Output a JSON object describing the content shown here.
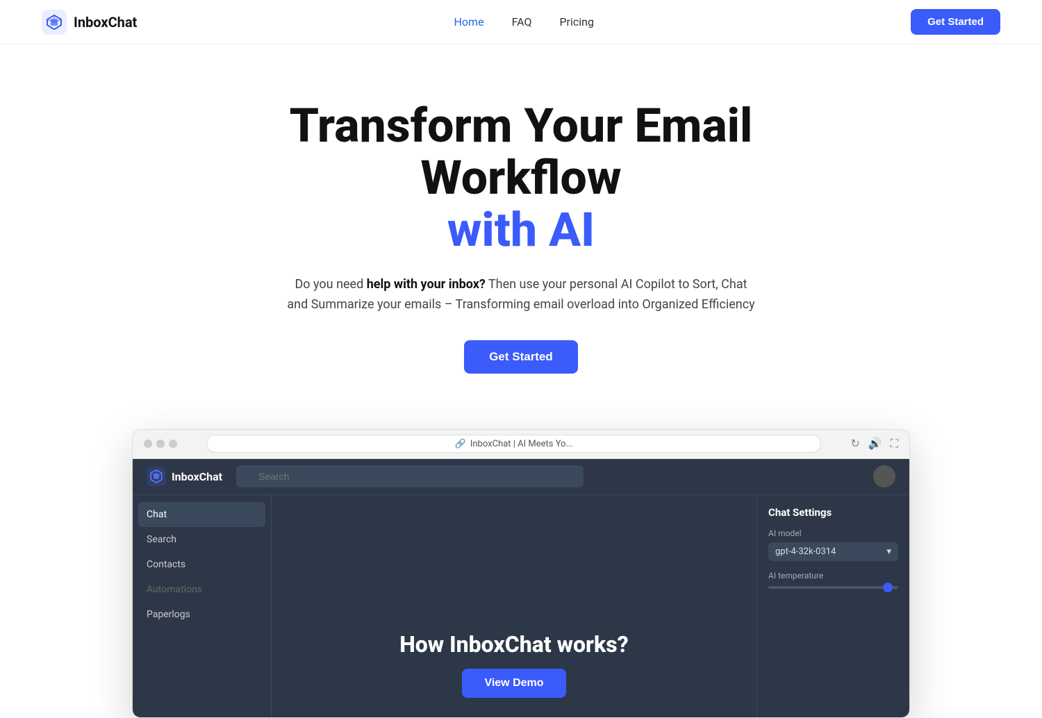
{
  "nav": {
    "logo_text": "InboxChat",
    "links": [
      {
        "label": "Home",
        "active": true
      },
      {
        "label": "FAQ",
        "active": false
      },
      {
        "label": "Pricing",
        "active": false
      }
    ],
    "cta_label": "Get Started"
  },
  "hero": {
    "title_line1": "Transform Your Email Workflow",
    "title_line2": "with AI",
    "subtitle_prefix": "Do you need ",
    "subtitle_bold": "help with your inbox?",
    "subtitle_suffix": " Then use your personal AI Copilot to Sort, Chat and Summarize your emails – Transforming email overload into Organized Efficiency",
    "cta_label": "Get Started"
  },
  "browser": {
    "url_text": "InboxChat | AI Meets Yo...",
    "url_icon": "🔗"
  },
  "app": {
    "logo": "InboxChat",
    "search_placeholder": "Search",
    "sidebar_items": [
      {
        "label": "Chat",
        "active": true
      },
      {
        "label": "Search",
        "active": false
      },
      {
        "label": "Contacts",
        "active": false
      },
      {
        "label": "Automations",
        "active": false,
        "disabled": true
      },
      {
        "label": "Paperlogs",
        "active": false
      }
    ],
    "settings": {
      "title": "Chat Settings",
      "ai_model_label": "AI model",
      "ai_model_value": "gpt-4-32k-0314",
      "ai_temp_label": "AI temperature"
    }
  },
  "how_section": {
    "title": "How InboxChat works?",
    "cta_label": "View Demo"
  }
}
